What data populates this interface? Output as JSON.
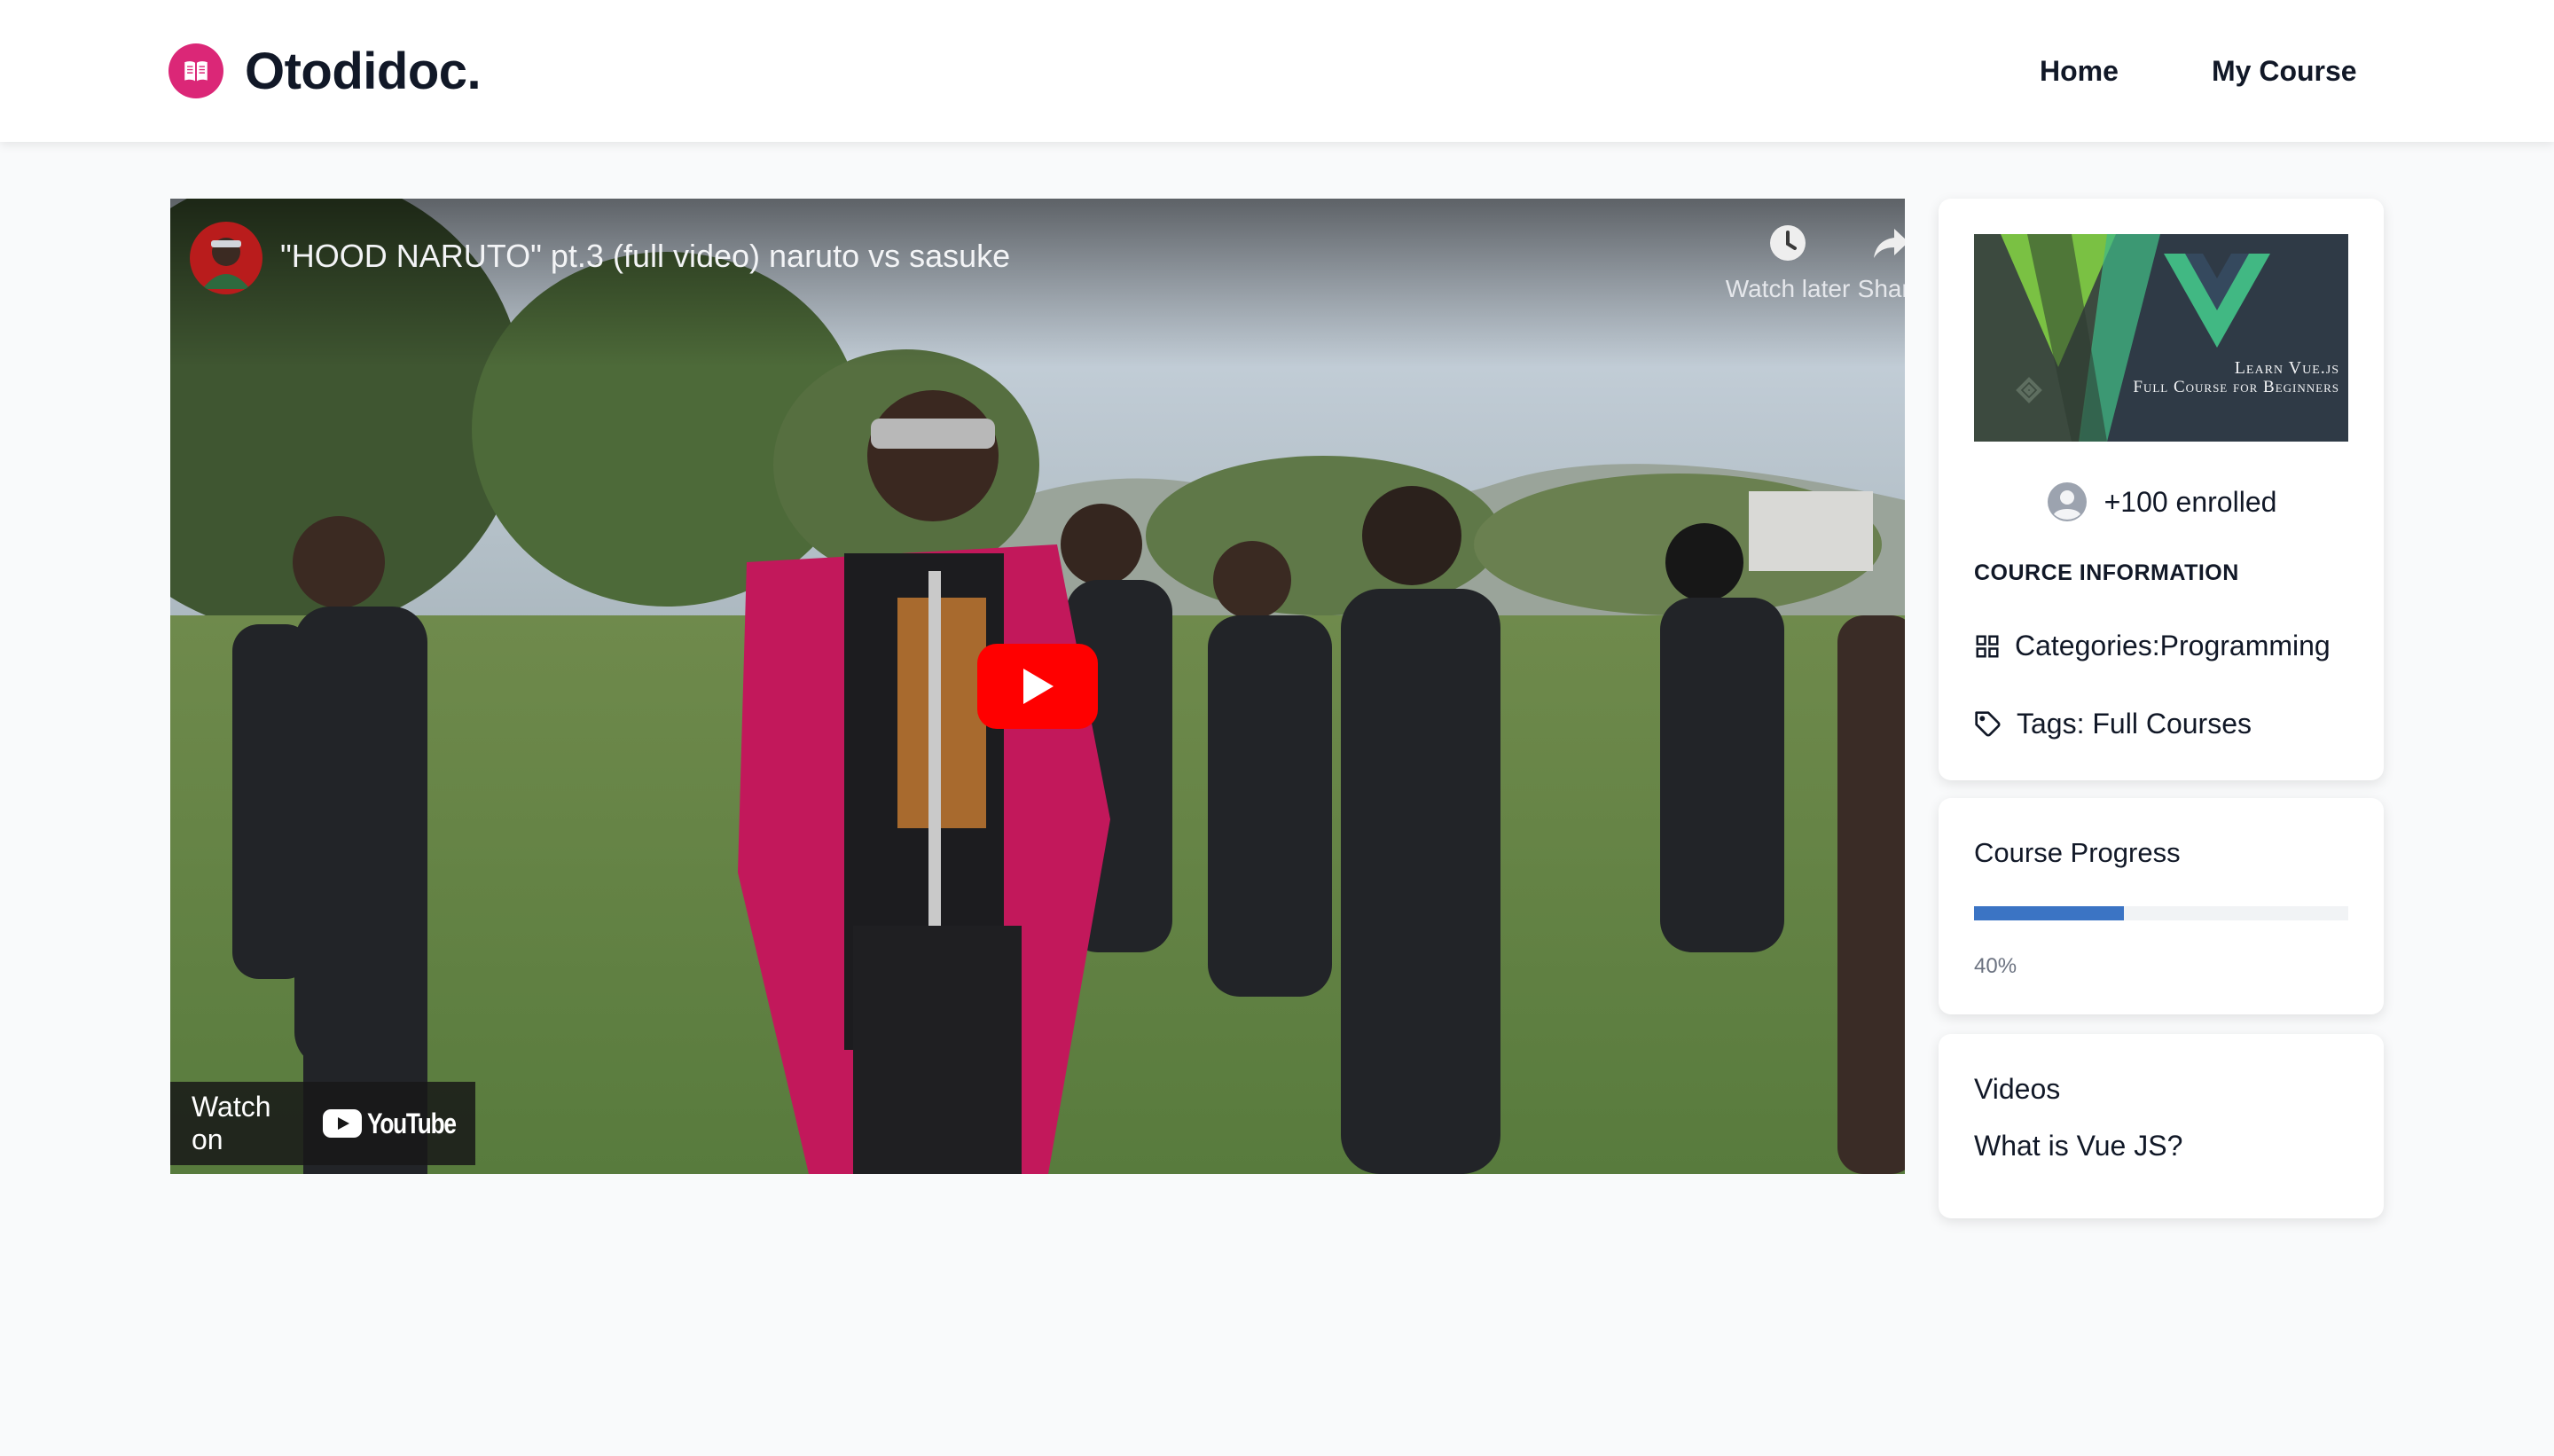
{
  "header": {
    "brand": "Otodidoc.",
    "nav": [
      {
        "label": "Home"
      },
      {
        "label": "My Course"
      }
    ]
  },
  "video": {
    "title": "\"HOOD NARUTO\" pt.3 (full video) naruto vs sasuke",
    "watch_later_label": "Watch later",
    "share_label": "Share",
    "watch_on_label": "Watch on",
    "youtube_wordmark": "YouTube"
  },
  "course": {
    "thumbnail_line1": "Learn Vue.js",
    "thumbnail_line2": "Full Course for Beginners",
    "enrolled": "+100 enrolled",
    "info_heading": "COURCE INFORMATION",
    "categories": "Categories:Programming",
    "tags": "Tags: Full Courses"
  },
  "progress": {
    "title": "Course Progress",
    "percent": 40,
    "label": "40%"
  },
  "videos": {
    "title": "Videos",
    "items": [
      "What is Vue JS?"
    ]
  },
  "colors": {
    "brand": "#db2777",
    "progress_fill": "#3b74c4",
    "youtube_red": "#ff0000"
  }
}
